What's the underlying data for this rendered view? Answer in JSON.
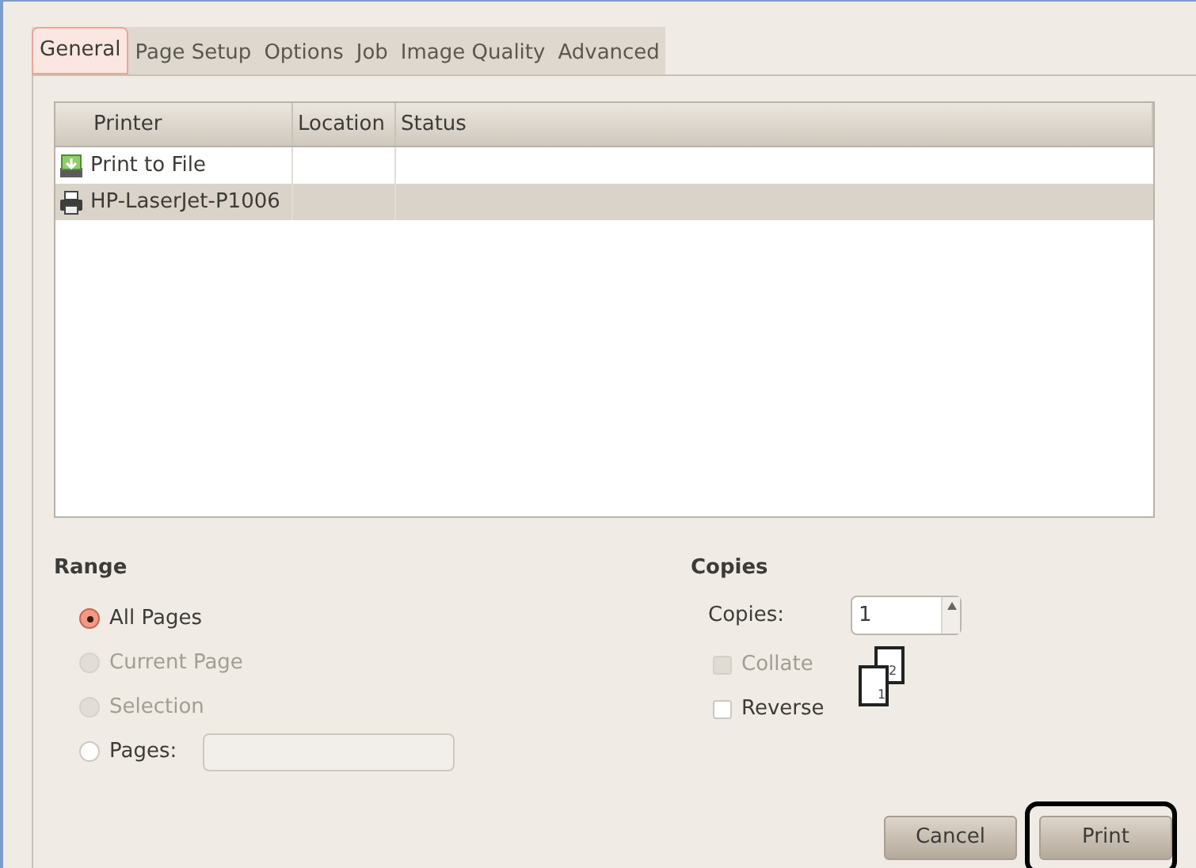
{
  "tabs": [
    {
      "label": "General",
      "selected": true
    },
    {
      "label": "Page Setup",
      "selected": false
    },
    {
      "label": "Options",
      "selected": false
    },
    {
      "label": "Job",
      "selected": false
    },
    {
      "label": "Image Quality",
      "selected": false
    },
    {
      "label": "Advanced",
      "selected": false
    }
  ],
  "printers": {
    "columns": [
      "Printer",
      "Location",
      "Status"
    ],
    "rows": [
      {
        "kind": "file",
        "name": "Print to File",
        "selected": false
      },
      {
        "kind": "printer",
        "name": "HP-LaserJet-P1006",
        "selected": true
      }
    ]
  },
  "range": {
    "title": "Range",
    "options": [
      {
        "label": "All Pages",
        "selected": true,
        "disabled": false
      },
      {
        "label": "Current Page",
        "selected": false,
        "disabled": true
      },
      {
        "label": "Selection",
        "selected": false,
        "disabled": true
      },
      {
        "label": "Pages:",
        "selected": false,
        "disabled": false,
        "field": true
      }
    ]
  },
  "copies": {
    "title": "Copies",
    "label": "Copies:",
    "value": "1",
    "checkboxes": [
      {
        "label": "Collate",
        "checked": false,
        "disabled": true
      },
      {
        "label": "Reverse",
        "checked": false,
        "disabled": false
      }
    ],
    "collate_pages": [
      "2",
      "1"
    ]
  },
  "buttons": [
    {
      "label": "Cancel",
      "highlighted": false
    },
    {
      "label": "Print",
      "highlighted": true
    }
  ]
}
